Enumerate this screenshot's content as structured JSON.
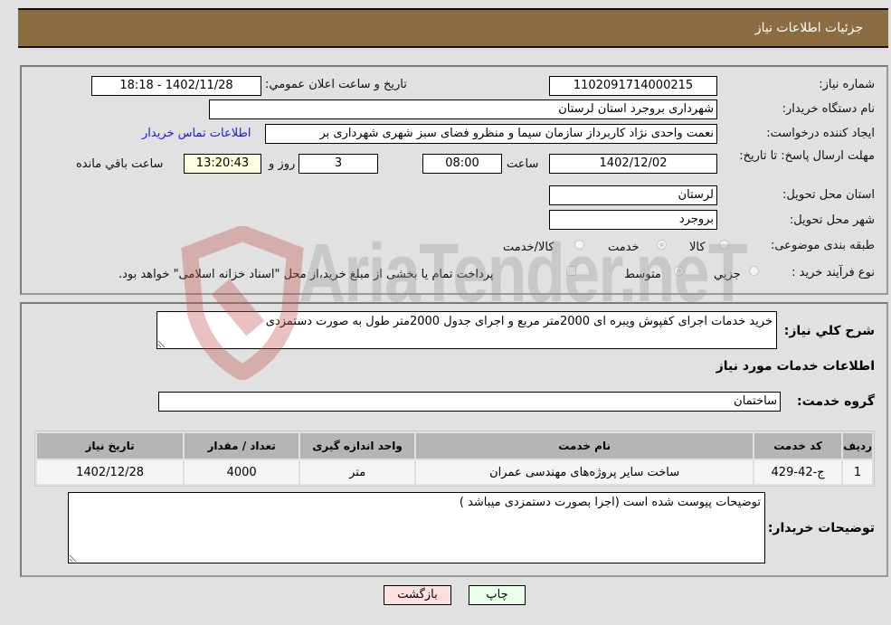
{
  "header": {
    "title": "جزئیات اطلاعات نیاز"
  },
  "details": {
    "need_number_label": "شماره نیاز:",
    "need_number": "1102091714000215",
    "announce_label": "تاریخ و ساعت اعلان عمومي:",
    "announce_value": "1402/11/28 - 18:18",
    "buyer_org_label": "نام دستگاه خریدار:",
    "buyer_org": "شهرداری بروجرد استان لرستان",
    "creator_label": "ایجاد کننده درخواست:",
    "creator": "نعمت واحدی نژاد کاربرداز سازمان سیما و منظرو فضای سبز شهری شهرداری بر",
    "contact_link": "اطلاعات تماس خریدار",
    "deadline_label": "مهلت ارسال پاسخ: تا تاریخ:",
    "deadline_date": "1402/12/02",
    "time_label": "ساعت",
    "deadline_time": "08:00",
    "days": "3",
    "days_label": "روز و",
    "remaining_time": "13:20:43",
    "remaining_label": "ساعت باقي مانده",
    "province_label": "استان محل تحویل:",
    "province": "لرستان",
    "city_label": "شهر محل تحویل:",
    "city": "بروجرد",
    "category_label": "طبقه بندی موضوعی:",
    "category_options": [
      {
        "label": "کالا",
        "checked": false
      },
      {
        "label": "خدمت",
        "checked": true
      },
      {
        "label": "کالا/خدمت",
        "checked": false
      }
    ],
    "process_label": "نوع فرآیند خرید :",
    "process_options": [
      {
        "label": "جزيي",
        "checked": false
      },
      {
        "label": "متوسط",
        "checked": true
      }
    ],
    "treasury_note": "پرداخت تمام یا بخشی از مبلغ خرید،از محل \"اسناد خزانه اسلامی\" خواهد بود."
  },
  "summary": {
    "description_label": "شرح کلي نياز:",
    "description": "خرید خدمات اجرای کفپوش ویبره ای 2000متر مربع و اجرای جدول 2000متر طول به صورت دستمزدی",
    "services_heading": "اطلاعات خدمات مورد نیاز",
    "service_group_label": "گروه خدمت:",
    "service_group": "ساختمان"
  },
  "table": {
    "headers": [
      "ردیف",
      "کد خدمت",
      "نام خدمت",
      "واحد اندازه گیری",
      "تعداد / مقدار",
      "تاریخ نیاز"
    ],
    "rows": [
      [
        "1",
        "ج-42-429",
        "ساخت سایر پروژه‌های مهندسی عمران",
        "متر",
        "4000",
        "1402/12/28"
      ]
    ]
  },
  "buyer_notes": {
    "label": "توضیحات خریدار:",
    "text": "توضیحات پیوست شده است (اجرا بصورت دستمزدی میباشد )"
  },
  "buttons": {
    "print": "چاپ",
    "back": "بازگشت"
  },
  "watermark": {
    "text": "AriaTender.neT"
  }
}
